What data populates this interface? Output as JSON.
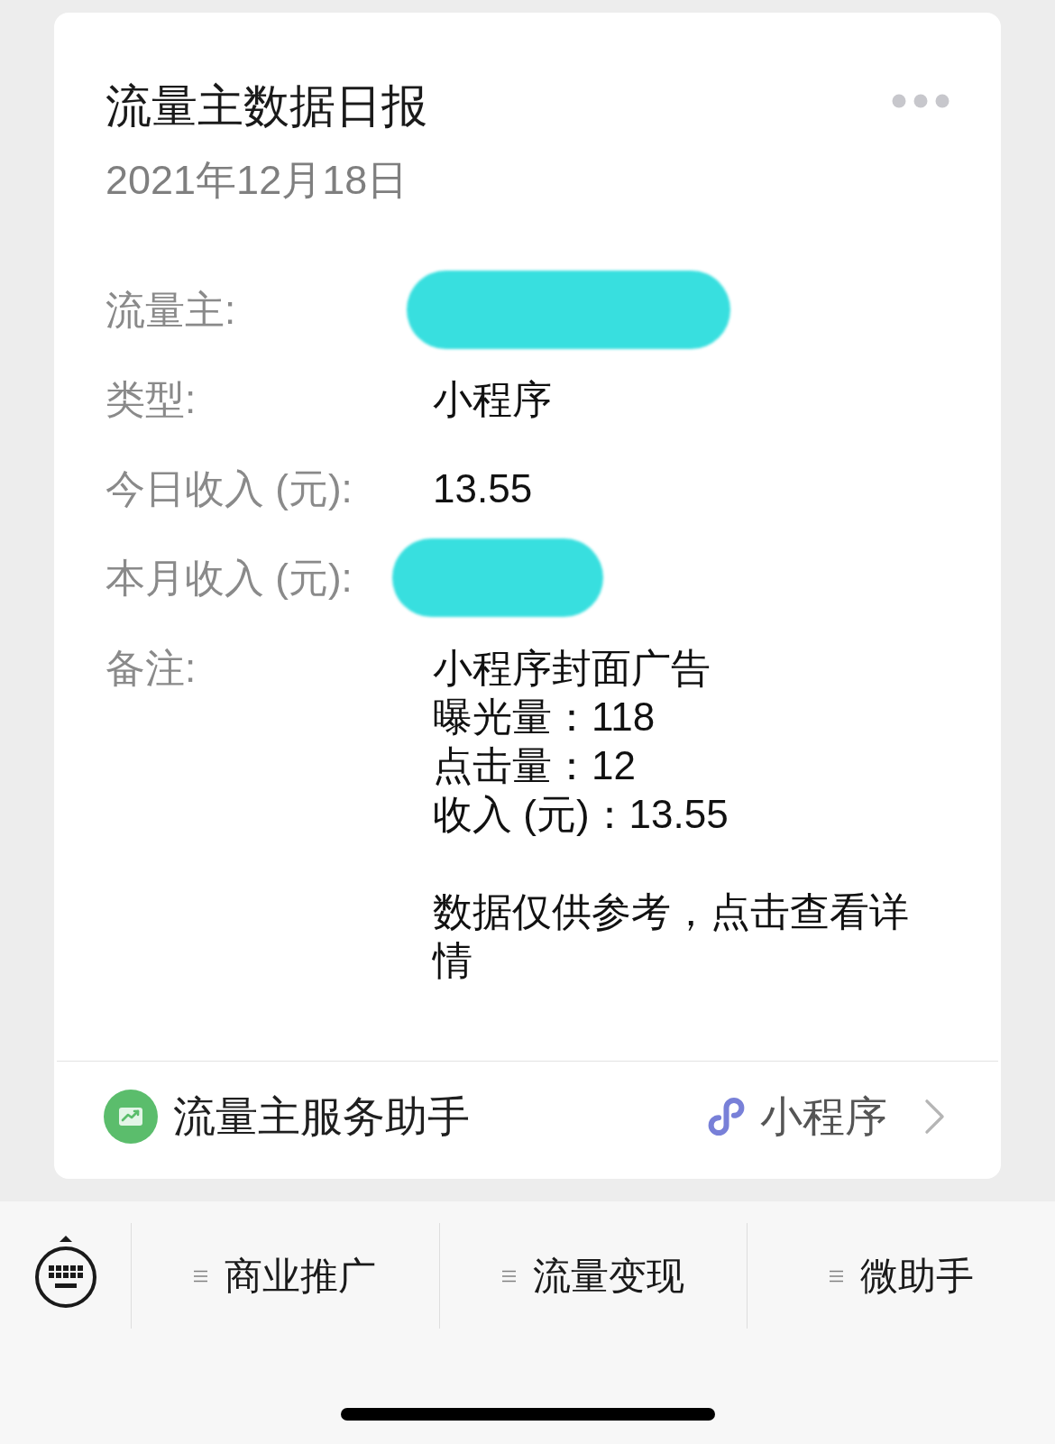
{
  "card": {
    "title": "流量主数据日报",
    "date": "2021年12月18日",
    "fields": [
      {
        "kind": "redacted",
        "label": "流量主:"
      },
      {
        "kind": "text",
        "label": "类型:",
        "value": "小程序"
      },
      {
        "kind": "text",
        "label": "今日收入 (元):",
        "value": "13.55"
      },
      {
        "kind": "redacted",
        "label": "本月收入 (元):"
      },
      {
        "kind": "note",
        "label": "备注:",
        "lines": [
          "小程序封面广告",
          "曝光量：118",
          "点击量：12",
          "收入 (元)：13.55"
        ],
        "note": "数据仅供参考，点击查看详情"
      }
    ],
    "footer": {
      "name": "流量主服务助手",
      "tag": "小程序"
    }
  },
  "menu_bar": {
    "items": [
      {
        "label": "商业推广"
      },
      {
        "label": "流量变现"
      },
      {
        "label": "微助手"
      }
    ]
  }
}
